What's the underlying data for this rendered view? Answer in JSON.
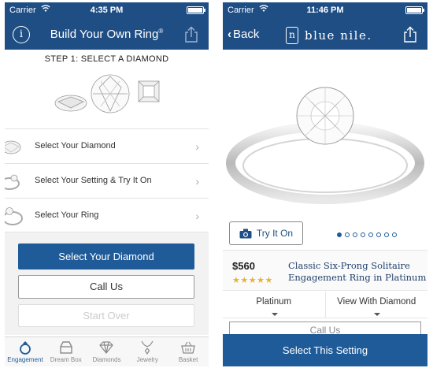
{
  "left": {
    "status": {
      "carrier": "Carrier",
      "time": "4:35 PM"
    },
    "nav": {
      "title": "Build Your Own Ring",
      "title_mark": "®",
      "info_icon": "info-icon",
      "share_icon": "share-icon"
    },
    "step_title": "STEP 1: SELECT A DIAMOND",
    "menu": [
      {
        "label": "Select Your Diamond",
        "icon": "diamond-thumb"
      },
      {
        "label": "Select Your Setting & Try It On",
        "icon": "setting-thumb"
      },
      {
        "label": "Select Your Ring",
        "icon": "ring-thumb"
      }
    ],
    "buttons": {
      "primary": "Select Your Diamond",
      "secondary": "Call Us",
      "disabled": "Start Over"
    },
    "tabs": [
      {
        "label": "Engagement",
        "icon": "engagement-ring-icon",
        "active": true
      },
      {
        "label": "Dream Box",
        "icon": "dream-box-icon",
        "active": false
      },
      {
        "label": "Diamonds",
        "icon": "diamond-icon",
        "active": false
      },
      {
        "label": "Jewelry",
        "icon": "necklace-icon",
        "active": false
      },
      {
        "label": "Basket",
        "icon": "basket-icon",
        "active": false
      }
    ]
  },
  "right": {
    "status": {
      "carrier": "Carrier",
      "time": "11:46 PM"
    },
    "nav": {
      "back": "Back",
      "logo_text": "blue nile.",
      "logo_mark": "n"
    },
    "try_on": "Try It On",
    "carousel": {
      "count": 8,
      "active_index": 0
    },
    "product": {
      "price": "$560",
      "rating": 5,
      "stars_text": "★★★★★",
      "name": "Classic Six-Prong Solitaire Engagement Ring in Platinum"
    },
    "options": {
      "metal": "Platinum",
      "view": "View With Diamond"
    },
    "call_us_peek": "Call Us",
    "cta": "Select This Setting"
  },
  "colors": {
    "brand_blue": "#1f4e85",
    "button_blue": "#1f5b98",
    "star_gold": "#e2b33c"
  }
}
